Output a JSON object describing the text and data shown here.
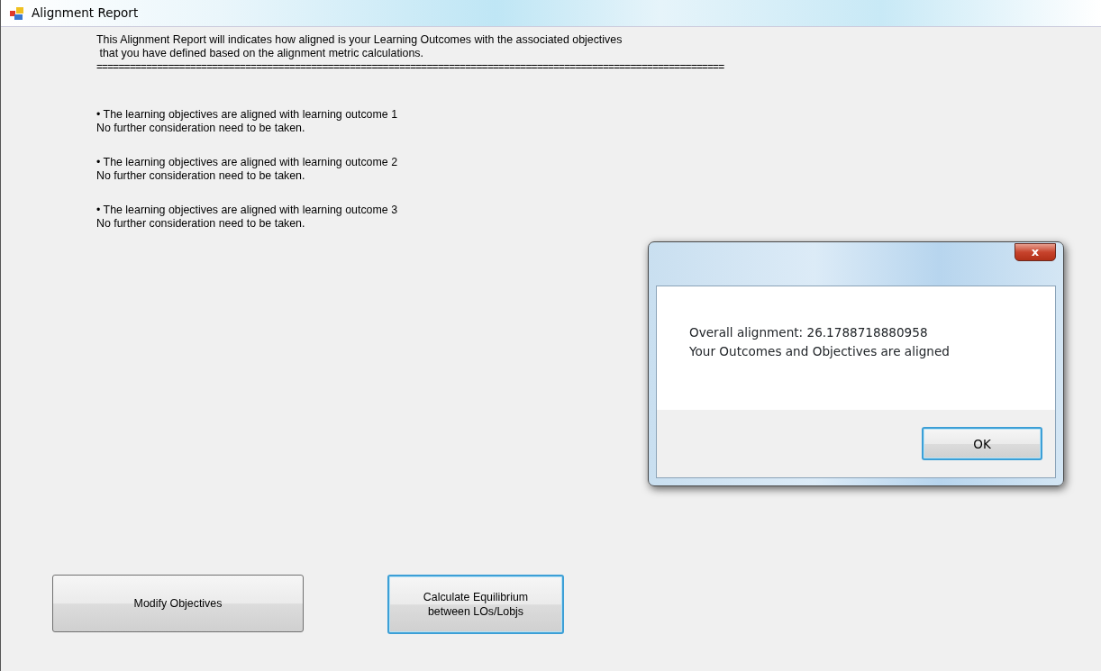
{
  "window": {
    "title": "Alignment Report"
  },
  "intro": [
    "This Alignment Report will indicates how aligned is your Learning Outcomes with the associated objectives",
    " that you have defined based on the alignment metric calculations.",
    "=================================================================================================================="
  ],
  "results": [
    {
      "finding": "• The learning objectives are aligned with learning outcome 1",
      "note": "No further consideration need to be taken."
    },
    {
      "finding": "• The learning objectives are aligned with learning outcome 2",
      "note": "No further consideration need to be taken."
    },
    {
      "finding": "• The learning objectives are aligned with learning outcome 3",
      "note": "No further consideration need to be taken."
    }
  ],
  "buttons": [
    {
      "label": "Modify Objectives",
      "focused": false
    },
    {
      "label": "Calculate Equilibrium between LOs/Lobjs",
      "focused": true
    }
  ],
  "dialog": {
    "close": "x",
    "lines": [
      "Overall alignment: 26.1788718880958",
      "Your Outcomes and Objectives are aligned"
    ],
    "buttons": [
      {
        "label": "OK",
        "focused": true
      }
    ]
  }
}
